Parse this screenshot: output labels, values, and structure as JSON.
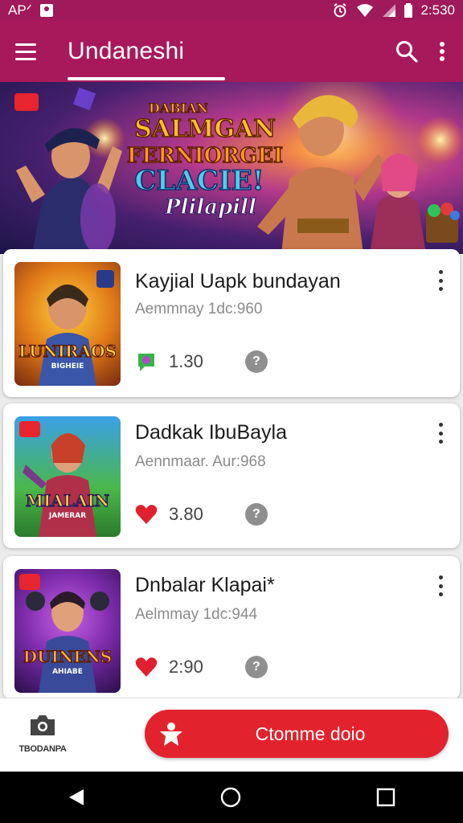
{
  "status_bar": {
    "left_text": "APᐟ",
    "time": "2:530"
  },
  "app_bar": {
    "title": "Undaneshi"
  },
  "banner": {
    "title_lines": [
      "DABIAN",
      "SALMGAN",
      "FERNIORGEI",
      "CLACIE!",
      "Plilapill"
    ]
  },
  "cards": [
    {
      "thumb_text": "LUNIRAOS",
      "thumb_subtext": "BIGHEIE",
      "title": "Kayjial Uapk bundayan",
      "subtitle": "Aemmnay 1dc:960",
      "stat_icon": "green-chat-icon",
      "stat_value": "1.30"
    },
    {
      "thumb_text": "MIALAIN",
      "thumb_subtext": "JAMERAR",
      "title": "Dadkak IbuBayla",
      "subtitle": "Aennmaar. Aur:968",
      "stat_icon": "heart-icon",
      "stat_value": "3.80"
    },
    {
      "thumb_text": "DUINENS",
      "thumb_subtext": "AHIABE",
      "title": "Dnbalar Klapai*",
      "subtitle": "Aelmmay 1dc:944",
      "stat_icon": "heart-icon",
      "stat_value": "2:90"
    }
  ],
  "bottom_bar": {
    "left_label": "TBODANPA",
    "cta_label": "Ctomme doio"
  },
  "colors": {
    "primary": "#a8195c",
    "accent": "#e2222d",
    "heart": "#e0202f",
    "chat_green": "#34b54a"
  }
}
